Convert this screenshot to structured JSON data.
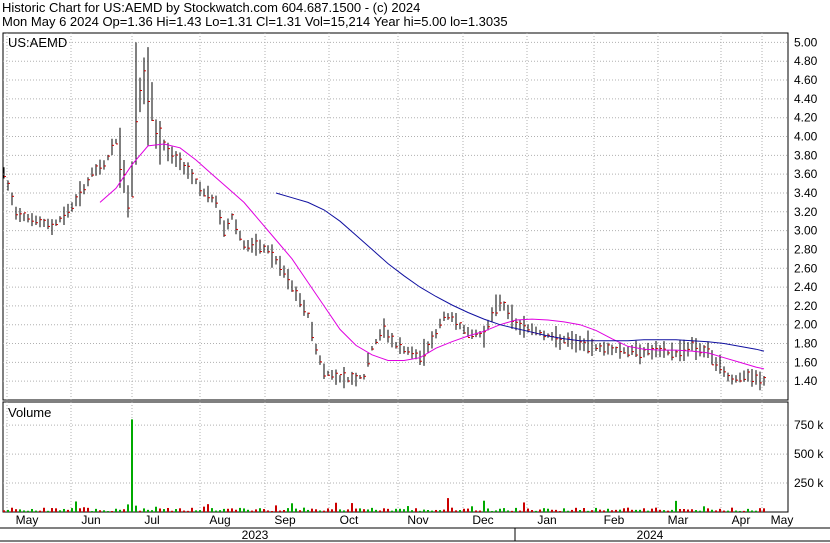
{
  "header": {
    "line1": "Historic Chart for US:AEMD by Stockwatch.com 604.687.1500 - (c) 2024",
    "line2": "Mon May  6 2024  Op=1.36  Hi=1.43  Lo=1.31  Cl=1.31  Vol=15,214  Year hi=5.00  lo=1.3035"
  },
  "chart_data": {
    "type": "line",
    "title": "US:AEMD",
    "price_axis": {
      "ylim": [
        1.2,
        5.1
      ],
      "ticks": [
        "5.00",
        "4.80",
        "4.60",
        "4.40",
        "4.20",
        "4.00",
        "3.80",
        "3.60",
        "3.40",
        "3.20",
        "3.00",
        "2.80",
        "2.60",
        "2.40",
        "2.20",
        "2.00",
        "1.80",
        "1.60",
        "1.40"
      ]
    },
    "volume_panel": {
      "label": "Volume",
      "ylim": [
        0,
        950000
      ],
      "ticks": [
        "750 k",
        "500 k",
        "250 k"
      ]
    },
    "months": [
      "May",
      "Jun",
      "Jul",
      "Aug",
      "Sep",
      "Oct",
      "Nov",
      "Dec",
      "Jan",
      "Feb",
      "Mar",
      "Apr",
      "May"
    ],
    "years": [
      "2023",
      "2024"
    ],
    "colors": {
      "ma_short": "#e000e0",
      "ma_long": "#1010a0",
      "bar_up": "#000000",
      "tick_close": "#cc0000",
      "vol_up": "#00aa00",
      "vol_down": "#cc0000",
      "grid": "#b0b0b0"
    },
    "price_anchors": [
      [
        0,
        3.6
      ],
      [
        3,
        3.2
      ],
      [
        8,
        3.1
      ],
      [
        12,
        3.05
      ],
      [
        16,
        3.2
      ],
      [
        20,
        3.45
      ],
      [
        22,
        3.6
      ],
      [
        25,
        3.7
      ],
      [
        28,
        3.95
      ],
      [
        30,
        3.6
      ],
      [
        31,
        3.3
      ],
      [
        32,
        3.55
      ],
      [
        33,
        4.3
      ],
      [
        34,
        4.4
      ],
      [
        35,
        4.55
      ],
      [
        37,
        4.3
      ],
      [
        38,
        4.0
      ],
      [
        42,
        3.8
      ],
      [
        46,
        3.65
      ],
      [
        50,
        3.4
      ],
      [
        53,
        3.3
      ],
      [
        55,
        3.0
      ],
      [
        57,
        3.15
      ],
      [
        60,
        2.85
      ],
      [
        66,
        2.8
      ],
      [
        70,
        2.55
      ],
      [
        72,
        2.4
      ],
      [
        76,
        2.1
      ],
      [
        78,
        1.75
      ],
      [
        80,
        1.5
      ],
      [
        83,
        1.45
      ],
      [
        86,
        1.42
      ],
      [
        90,
        1.45
      ],
      [
        92,
        1.75
      ],
      [
        95,
        1.95
      ],
      [
        98,
        1.78
      ],
      [
        104,
        1.65
      ],
      [
        108,
        1.9
      ],
      [
        110,
        2.1
      ],
      [
        113,
        2.05
      ],
      [
        116,
        1.9
      ],
      [
        120,
        1.9
      ],
      [
        122,
        2.1
      ],
      [
        124,
        2.25
      ],
      [
        126,
        2.15
      ],
      [
        128,
        2.0
      ],
      [
        132,
        1.95
      ],
      [
        138,
        1.85
      ],
      [
        144,
        1.8
      ],
      [
        150,
        1.75
      ],
      [
        156,
        1.72
      ],
      [
        162,
        1.72
      ],
      [
        168,
        1.7
      ],
      [
        172,
        1.78
      ],
      [
        176,
        1.7
      ],
      [
        180,
        1.5
      ],
      [
        182,
        1.42
      ],
      [
        186,
        1.45
      ],
      [
        189,
        1.4
      ],
      [
        190,
        1.4
      ]
    ],
    "ma_short_anchors": [
      [
        24,
        3.3
      ],
      [
        28,
        3.45
      ],
      [
        32,
        3.7
      ],
      [
        36,
        3.9
      ],
      [
        40,
        3.92
      ],
      [
        44,
        3.88
      ],
      [
        48,
        3.75
      ],
      [
        52,
        3.6
      ],
      [
        56,
        3.45
      ],
      [
        60,
        3.3
      ],
      [
        64,
        3.1
      ],
      [
        68,
        2.9
      ],
      [
        72,
        2.7
      ],
      [
        76,
        2.45
      ],
      [
        80,
        2.2
      ],
      [
        84,
        1.95
      ],
      [
        88,
        1.78
      ],
      [
        92,
        1.68
      ],
      [
        96,
        1.62
      ],
      [
        100,
        1.62
      ],
      [
        104,
        1.65
      ],
      [
        108,
        1.75
      ],
      [
        112,
        1.82
      ],
      [
        116,
        1.88
      ],
      [
        120,
        1.93
      ],
      [
        124,
        2.0
      ],
      [
        128,
        2.05
      ],
      [
        132,
        2.06
      ],
      [
        136,
        2.05
      ],
      [
        140,
        2.03
      ],
      [
        144,
        2.0
      ],
      [
        148,
        1.94
      ],
      [
        152,
        1.85
      ],
      [
        156,
        1.77
      ],
      [
        160,
        1.74
      ],
      [
        164,
        1.73
      ],
      [
        168,
        1.73
      ],
      [
        172,
        1.72
      ],
      [
        176,
        1.7
      ],
      [
        180,
        1.65
      ],
      [
        184,
        1.6
      ],
      [
        188,
        1.55
      ],
      [
        190,
        1.53
      ]
    ],
    "ma_long_anchors": [
      [
        68,
        3.4
      ],
      [
        72,
        3.35
      ],
      [
        76,
        3.3
      ],
      [
        80,
        3.22
      ],
      [
        84,
        3.1
      ],
      [
        88,
        2.95
      ],
      [
        92,
        2.8
      ],
      [
        96,
        2.65
      ],
      [
        100,
        2.52
      ],
      [
        104,
        2.4
      ],
      [
        108,
        2.3
      ],
      [
        112,
        2.21
      ],
      [
        116,
        2.13
      ],
      [
        120,
        2.06
      ],
      [
        124,
        2.0
      ],
      [
        128,
        1.96
      ],
      [
        132,
        1.92
      ],
      [
        136,
        1.88
      ],
      [
        140,
        1.85
      ],
      [
        144,
        1.83
      ],
      [
        148,
        1.83
      ],
      [
        152,
        1.83
      ],
      [
        156,
        1.83
      ],
      [
        160,
        1.84
      ],
      [
        164,
        1.84
      ],
      [
        168,
        1.84
      ],
      [
        172,
        1.83
      ],
      [
        176,
        1.82
      ],
      [
        180,
        1.8
      ],
      [
        184,
        1.77
      ],
      [
        188,
        1.74
      ],
      [
        190,
        1.72
      ]
    ],
    "volume_spike": {
      "bar": 32,
      "value": 800000
    }
  }
}
